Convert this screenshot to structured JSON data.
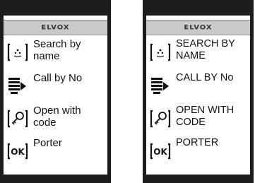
{
  "brand": {
    "logo_text": "ELVOX"
  },
  "screens": [
    {
      "items": [
        {
          "label": "Search by\nname",
          "icon": "search-name-icon"
        },
        {
          "label": "Call by No",
          "icon": "call-list-icon"
        },
        {
          "label": "Open with\ncode",
          "icon": "key-code-icon"
        },
        {
          "label": "Porter",
          "icon": "ok-porter-icon"
        }
      ]
    },
    {
      "items": [
        {
          "label": "SEARCH BY\nNAME",
          "icon": "search-name-icon"
        },
        {
          "label": "CALL BY No",
          "icon": "call-list-icon"
        },
        {
          "label": "OPEN WITH\nCODE",
          "icon": "key-code-icon"
        },
        {
          "label": "PORTER",
          "icon": "ok-porter-icon"
        }
      ]
    }
  ]
}
